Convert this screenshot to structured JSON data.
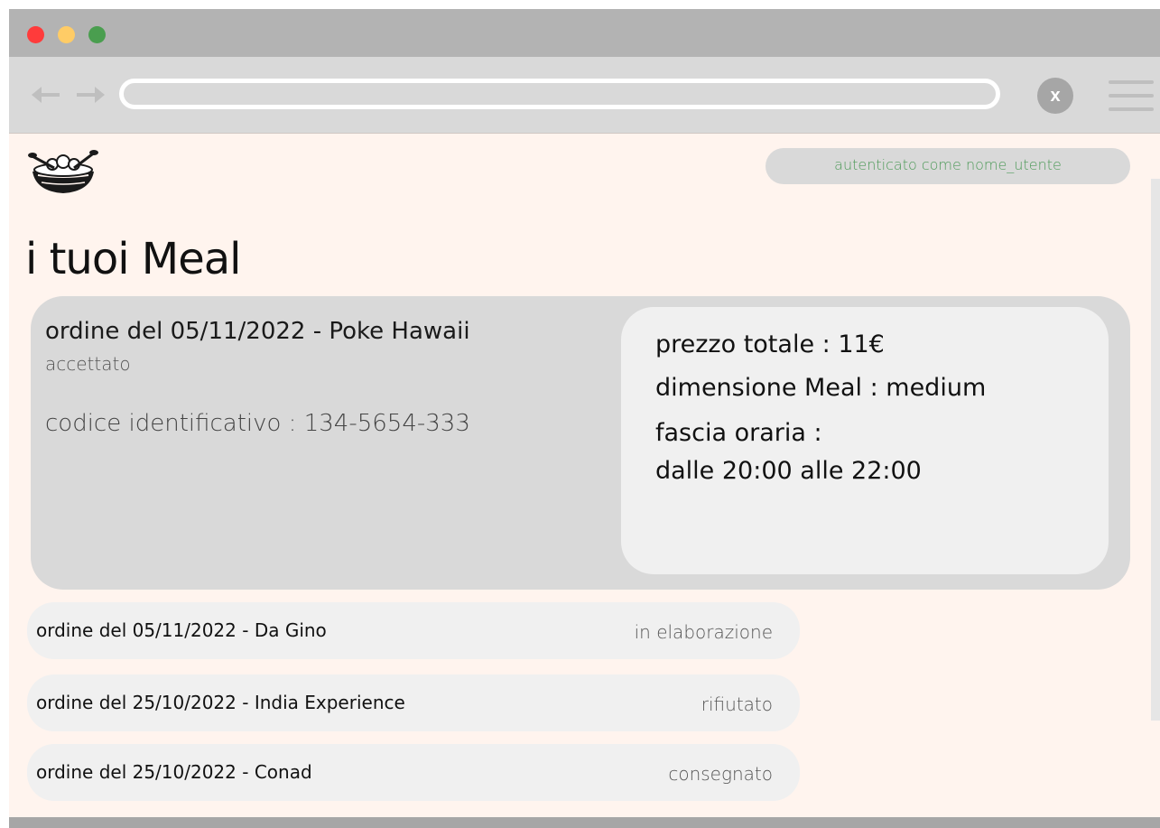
{
  "header": {
    "auth_text": "autenticato come nome_utente",
    "accent_green": "#4e9a59"
  },
  "browser": {
    "close_label": "x",
    "window_dots": [
      "#ff3b3b",
      "#ffcc66",
      "#4a9e4f"
    ]
  },
  "page": {
    "title": "i tuoi Meal"
  },
  "featured_order": {
    "title": "ordine del 05/11/2022 - Poke Hawaii",
    "status": "accettato",
    "code": "codice identificativo : 134-5654-333",
    "details": {
      "price": "prezzo totale : 11€",
      "size": "dimensione Meal : medium",
      "slot_label": "fascia oraria :",
      "slot_value": "dalle 20:00 alle 22:00"
    }
  },
  "orders": [
    {
      "title": "ordine del 05/11/2022 - Da Gino",
      "status": "in elaborazione"
    },
    {
      "title": "ordine del 25/10/2022 - India Experience",
      "status": "rifiutato"
    },
    {
      "title": "ordine del 25/10/2022 - Conad",
      "status": "consegnato"
    }
  ]
}
